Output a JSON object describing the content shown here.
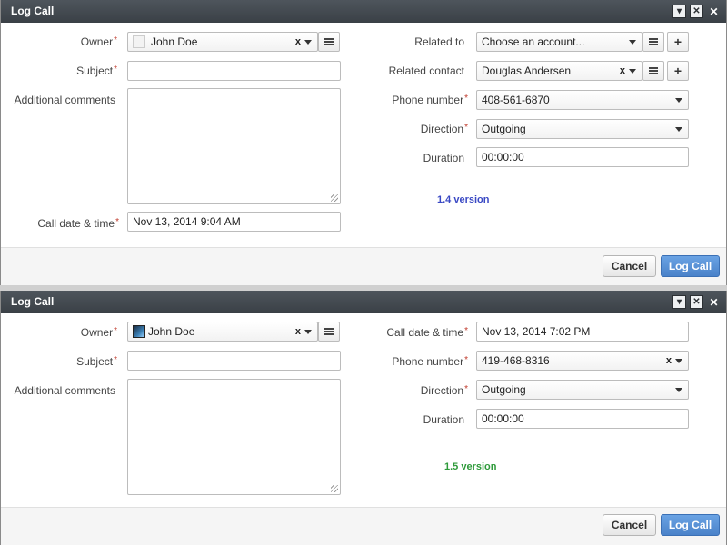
{
  "dialog1": {
    "title": "Log Call",
    "owner_label": "Owner",
    "owner_value": "John Doe",
    "subject_label": "Subject",
    "subject_value": "",
    "comments_label": "Additional comments",
    "calldate_label": "Call date & time",
    "calldate_value": "Nov 13, 2014 9:04 AM",
    "related_to_label": "Related to",
    "related_to_placeholder": "Choose an account...",
    "related_contact_label": "Related contact",
    "related_contact_value": "Douglas Andersen",
    "phone_label": "Phone number",
    "phone_value": "408-561-6870",
    "direction_label": "Direction",
    "direction_value": "Outgoing",
    "duration_label": "Duration",
    "duration_value": "00:00:00",
    "version": "1.4 version",
    "cancel_label": "Cancel",
    "log_label": "Log Call"
  },
  "dialog2": {
    "title": "Log Call",
    "owner_label": "Owner",
    "owner_value": "John Doe",
    "subject_label": "Subject",
    "subject_value": "",
    "comments_label": "Additional comments",
    "calldate_label": "Call date & time",
    "calldate_value": "Nov 13, 2014 7:02 PM",
    "phone_label": "Phone number",
    "phone_value": "419-468-8316",
    "direction_label": "Direction",
    "direction_value": "Outgoing",
    "duration_label": "Duration",
    "duration_value": "00:00:00",
    "version": "1.5 version",
    "cancel_label": "Cancel",
    "log_label": "Log Call"
  },
  "colors": {
    "version_1_4": "#3a49c4",
    "version_1_5": "#2e9a3a",
    "primary_button": "#4a82c9",
    "titlebar": "#3f454b",
    "required": "#c0392b"
  },
  "icons": {
    "titlebar": [
      "minimize-icon",
      "maximize-icon",
      "close-icon"
    ],
    "field": [
      "chevron-down-icon",
      "clear-icon",
      "list-icon",
      "plus-icon",
      "avatar-icon",
      "resize-grip-icon"
    ]
  }
}
